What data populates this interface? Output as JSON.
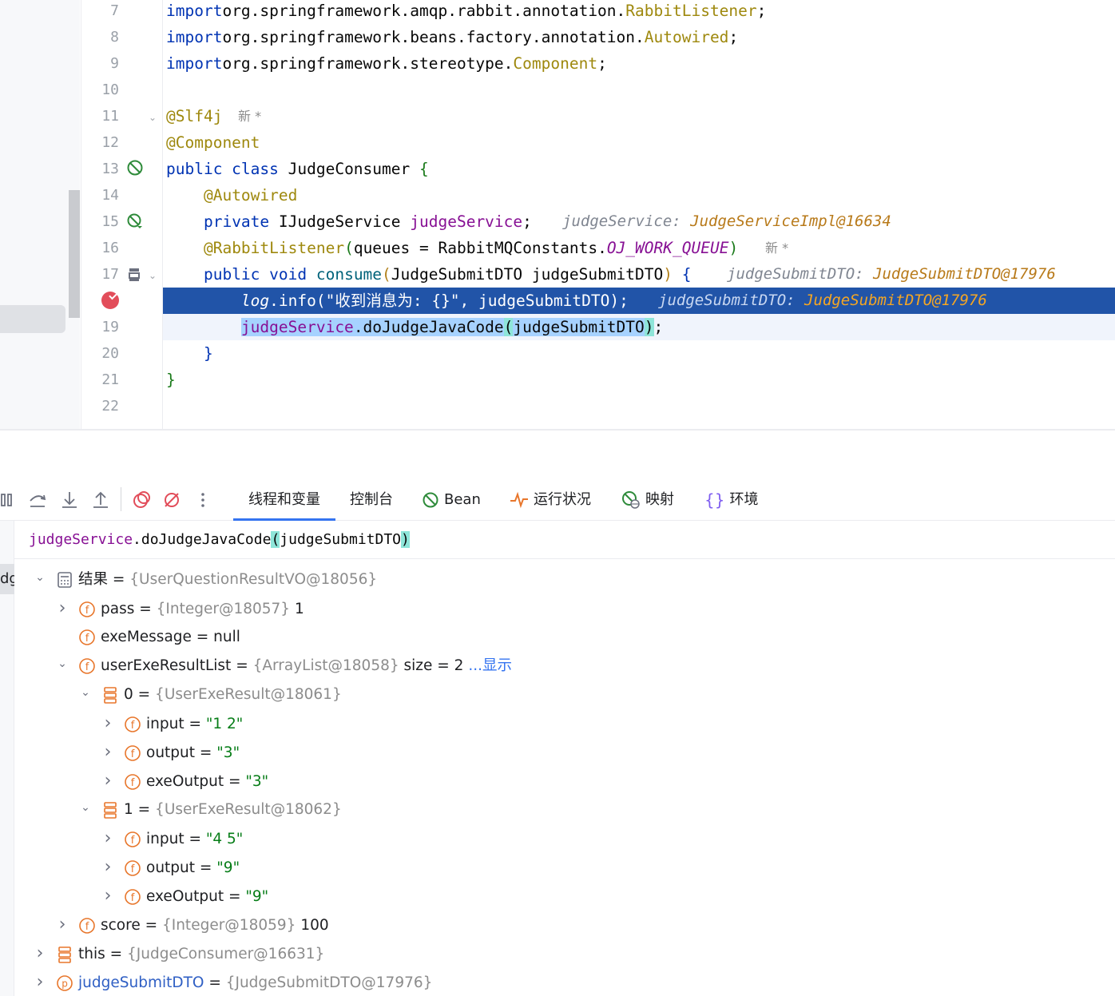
{
  "editor": {
    "lines": [
      {
        "num": "7",
        "parts": [
          [
            "kw",
            "import"
          ],
          [
            "",
            "org.springframework.amqp.rabbit.annotation."
          ],
          [
            "ann",
            "RabbitListener"
          ],
          [
            "",
            ";"
          ]
        ]
      },
      {
        "num": "8",
        "parts": [
          [
            "kw",
            "import"
          ],
          [
            "",
            "org.springframework.beans.factory.annotation."
          ],
          [
            "ann",
            "Autowired"
          ],
          [
            "",
            ";"
          ]
        ]
      },
      {
        "num": "9",
        "parts": [
          [
            "kw",
            "import"
          ],
          [
            "",
            "org.springframework.stereotype."
          ],
          [
            "ann",
            "Component"
          ],
          [
            "",
            ";"
          ]
        ]
      },
      {
        "num": "10",
        "parts": []
      },
      {
        "num": "11",
        "parts": [
          [
            "ann",
            "@Slf4j"
          ]
        ]
      },
      {
        "num": "12",
        "parts": [
          [
            "ann",
            "@Component"
          ]
        ]
      },
      {
        "num": "13",
        "parts": [
          [
            "kw",
            "public class "
          ],
          [
            "",
            "JudgeConsumer "
          ],
          [
            "ok",
            "{"
          ]
        ]
      },
      {
        "num": "14",
        "parts": [
          [
            "",
            "    "
          ],
          [
            "ann",
            "@Autowired"
          ]
        ]
      },
      {
        "num": "15",
        "parts": [
          [
            "",
            "    "
          ],
          [
            "kw",
            "private "
          ],
          [
            "",
            "IJudgeService "
          ],
          [
            "fld",
            "judgeService"
          ],
          [
            "",
            ";"
          ]
        ]
      },
      {
        "num": "16",
        "parts": [
          [
            "",
            "    "
          ],
          [
            "ann",
            "@RabbitListener"
          ],
          [
            "ok",
            "("
          ],
          [
            "",
            "queues = RabbitMQConstants."
          ],
          [
            "cst",
            "OJ_WORK_QUEUE"
          ],
          [
            "ok",
            ")"
          ]
        ]
      },
      {
        "num": "17",
        "parts": [
          [
            "",
            "    "
          ],
          [
            "kw",
            "public void "
          ],
          [
            "fn",
            "consume"
          ],
          [
            "yel",
            "("
          ],
          [
            "",
            "JudgeSubmitDTO judgeSubmitDTO"
          ],
          [
            "yel",
            ")"
          ],
          [
            "",
            " "
          ],
          [
            "kw",
            "{"
          ]
        ]
      },
      {
        "num": "18",
        "parts": [
          [
            "",
            "        "
          ],
          [
            "it",
            "log"
          ],
          [
            "",
            ".info(\"收到消息为: {}\", judgeSubmitDTO);"
          ]
        ]
      },
      {
        "num": "19",
        "parts": [
          [
            "",
            "        "
          ],
          [
            "fldsel",
            "judgeService"
          ],
          [
            "sel",
            ".doJudgeJavaCode"
          ],
          [
            "brk",
            "("
          ],
          [
            "sel",
            "judgeSubmitDTO"
          ],
          [
            "brk",
            ")"
          ],
          [
            "",
            ";"
          ]
        ]
      },
      {
        "num": "20",
        "parts": [
          [
            "",
            "    "
          ],
          [
            "kw",
            "}"
          ]
        ]
      },
      {
        "num": "21",
        "parts": [
          [
            "ok",
            "}"
          ]
        ]
      },
      {
        "num": "22",
        "parts": []
      }
    ],
    "new_tag": "新 *",
    "inlay_15_label": "judgeService: ",
    "inlay_15_value": "JudgeServiceImpl@16634",
    "inlay_17_label": "judgeSubmitDTO: ",
    "inlay_17_value": "JudgeSubmitDTO@17976",
    "inlay_18_label": "judgeSubmitDTO: ",
    "inlay_18_value": "JudgeSubmitDTO@17976"
  },
  "debug": {
    "tabs": [
      {
        "label": "线程和变量",
        "icon": "",
        "active": true
      },
      {
        "label": "控制台",
        "icon": ""
      },
      {
        "label": "Bean",
        "icon": "bean-icon"
      },
      {
        "label": "运行状况",
        "icon": "pulse-icon"
      },
      {
        "label": "映射",
        "icon": "globe-icon"
      },
      {
        "label": "环境",
        "icon": "braces-icon"
      }
    ],
    "toolbar_icons": [
      "pause-icon",
      "step-over-icon",
      "step-into-icon",
      "step-out-icon",
      "view-breakpoints-icon",
      "mute-breakpoints-icon",
      "more-icon"
    ],
    "frame_label": "dg",
    "expression": {
      "obj": "judgeService",
      "method": ".doJudgeJavaCode",
      "open": "(",
      "arg": "judgeSubmitDTO",
      "close": ")"
    }
  },
  "variables": [
    {
      "depth": 0,
      "chev": "down",
      "icon": "calc-icon",
      "name": "结果",
      "eq": " = ",
      "type": "{UserQuestionResultVO@18056}",
      "value": "",
      "extra": ""
    },
    {
      "depth": 1,
      "chev": "right",
      "icon": "field-icon",
      "name": "pass",
      "eq": " = ",
      "type": "{Integer@18057}",
      "value": " 1",
      "extra": ""
    },
    {
      "depth": 1,
      "chev": "",
      "icon": "field-icon",
      "name": "exeMessage",
      "eq": " = ",
      "type": "",
      "value": "null",
      "extra": ""
    },
    {
      "depth": 1,
      "chev": "down",
      "icon": "field-icon",
      "name": "userExeResultList",
      "eq": " = ",
      "type": "{ArrayList@18058}",
      "value": "  size = 2 ",
      "extra": "...显示"
    },
    {
      "depth": 2,
      "chev": "down",
      "icon": "stack-icon",
      "name": "0",
      "eq": " = ",
      "type": "{UserExeResult@18061}",
      "value": "",
      "extra": ""
    },
    {
      "depth": 3,
      "chev": "right",
      "icon": "field-icon",
      "name": "input",
      "eq": " = ",
      "type": "",
      "str": "\"1 2\"",
      "extra": ""
    },
    {
      "depth": 3,
      "chev": "right",
      "icon": "field-icon",
      "name": "output",
      "eq": " = ",
      "type": "",
      "str": "\"3\"",
      "extra": ""
    },
    {
      "depth": 3,
      "chev": "right",
      "icon": "field-icon",
      "name": "exeOutput",
      "eq": " = ",
      "type": "",
      "str": "\"3\"",
      "extra": ""
    },
    {
      "depth": 2,
      "chev": "down",
      "icon": "stack-icon",
      "name": "1",
      "eq": " = ",
      "type": "{UserExeResult@18062}",
      "value": "",
      "extra": ""
    },
    {
      "depth": 3,
      "chev": "right",
      "icon": "field-icon",
      "name": "input",
      "eq": " = ",
      "type": "",
      "str": "\"4 5\"",
      "extra": ""
    },
    {
      "depth": 3,
      "chev": "right",
      "icon": "field-icon",
      "name": "output",
      "eq": " = ",
      "type": "",
      "str": "\"9\"",
      "extra": ""
    },
    {
      "depth": 3,
      "chev": "right",
      "icon": "field-icon",
      "name": "exeOutput",
      "eq": " = ",
      "type": "",
      "str": "\"9\"",
      "extra": ""
    },
    {
      "depth": 1,
      "chev": "right",
      "icon": "field-icon",
      "name": "score",
      "eq": " = ",
      "type": "{Integer@18059}",
      "value": " 100",
      "extra": ""
    },
    {
      "depth": 0,
      "chev": "right",
      "icon": "stack-icon",
      "name": "this",
      "eq": " = ",
      "type": "{JudgeConsumer@16631}",
      "value": "",
      "extra": ""
    },
    {
      "depth": 0,
      "chev": "right",
      "icon": "param-icon",
      "name": "judgeSubmitDTO",
      "eq": " = ",
      "type": "{JudgeSubmitDTO@17976}",
      "value": "",
      "extra": "",
      "param": true
    }
  ],
  "colors": {
    "accent": "#3574f0",
    "selection": "#2154a8",
    "breakpoint": "#e24d5a",
    "field_icon": "#e8762b"
  }
}
